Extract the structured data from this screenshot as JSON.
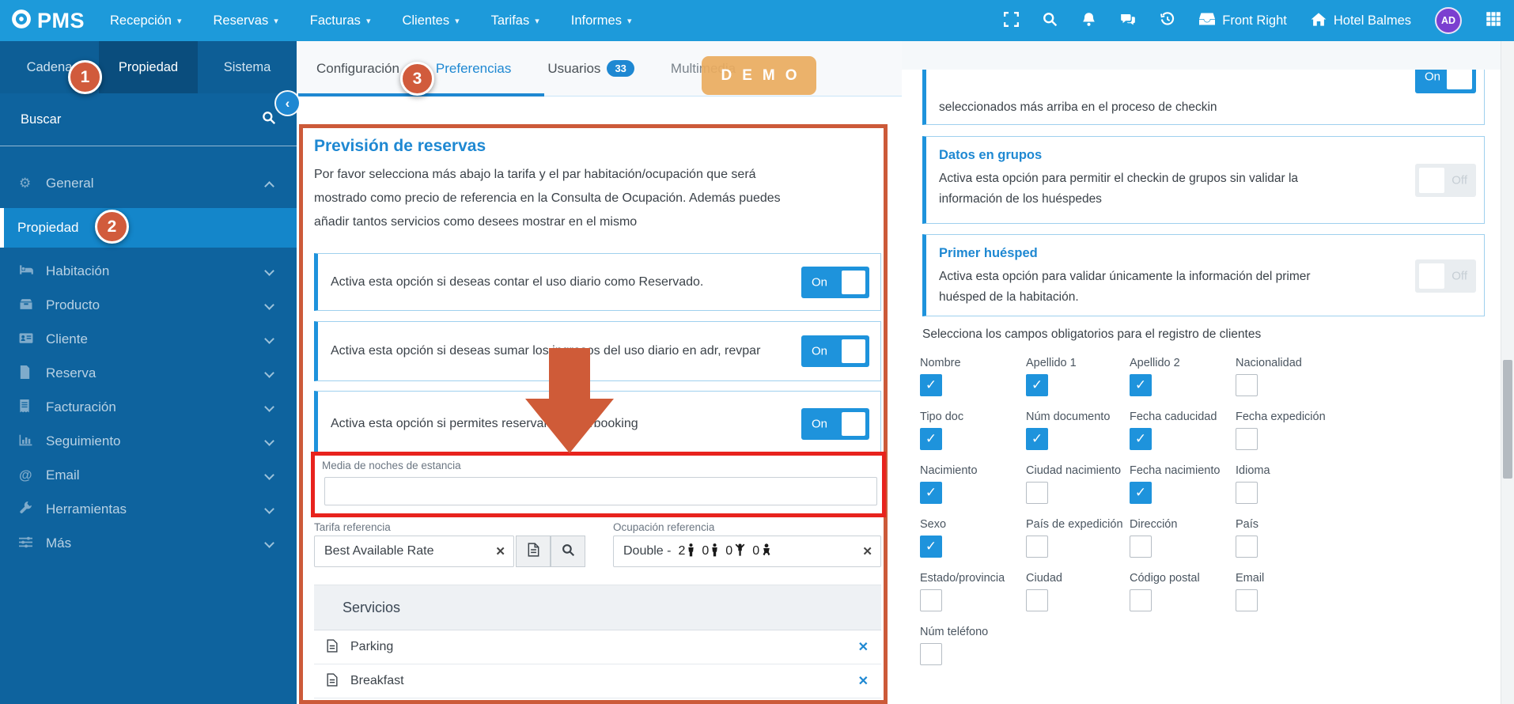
{
  "icons": {
    "check": "✓",
    "close": "✕",
    "caret_down": "▾",
    "chevron_left": "‹",
    "gear": "⚙",
    "at": "@"
  },
  "navbar": {
    "logo_text": "PMS",
    "menus": [
      "Recepción",
      "Reservas",
      "Facturas",
      "Clientes",
      "Tarifas",
      "Informes"
    ],
    "workstation_label": "Front Right",
    "hotel_label": "Hotel Balmes",
    "avatar_initials": "AD"
  },
  "sidebar": {
    "tabs": [
      "Cadena",
      "Propiedad",
      "Sistema"
    ],
    "search_placeholder": "Buscar",
    "items": [
      {
        "label": "General"
      },
      {
        "label": "Propiedad"
      },
      {
        "label": "Habitación"
      },
      {
        "label": "Producto"
      },
      {
        "label": "Cliente"
      },
      {
        "label": "Reserva"
      },
      {
        "label": "Facturación"
      },
      {
        "label": "Seguimiento"
      },
      {
        "label": "Email"
      },
      {
        "label": "Herramientas"
      },
      {
        "label": "Más"
      }
    ]
  },
  "content_tabs": {
    "configuracion": "Configuración",
    "preferencias": "Preferencias",
    "usuarios": "Usuarios",
    "usuarios_badge": "33",
    "multimedia": "Multimedia"
  },
  "demo_badge": "DEMO",
  "callout_numbers": {
    "one": "1",
    "two": "2",
    "three": "3"
  },
  "forecast": {
    "title": "Previsión de reservas",
    "description": "Por favor selecciona más abajo la tarifa y el par habitación/ocupación que será mostrado como precio de referencia en la Consulta de Ocupación. Además puedes añadir tantos servicios como desees mostrar en el mismo",
    "toggles": [
      {
        "label": "Activa esta opción si deseas contar el uso diario como Reservado.",
        "state": "On"
      },
      {
        "label": "Activa esta opción si deseas sumar los ingresos del uso diario en adr, revpar",
        "state": "On"
      },
      {
        "label": "Activa esta opción si permites reservar en overbooking",
        "state": "On"
      }
    ],
    "avg_nights_label": "Media de noches de estancia",
    "avg_nights_value": "",
    "rate_label": "Tarifa referencia",
    "rate_value": "Best Available Rate",
    "occupancy_label": "Ocupación referencia",
    "occupancy": {
      "room_type": "Double -",
      "adults": "2",
      "adults_extra": "0",
      "children": "0",
      "babies": "0"
    },
    "services_title": "Servicios",
    "services": [
      "Parking",
      "Breakfast"
    ]
  },
  "checkin": {
    "card_checkin_text": "seleccionados más arriba en el proceso de checkin",
    "card_checkin_state": "On",
    "groups_title": "Datos en grupos",
    "groups_text": "Activa esta opción para permitir el checkin de grupos sin validar la información de los huéspedes",
    "groups_state": "Off",
    "first_guest_title": "Primer huésped",
    "first_guest_text": "Activa esta opción para validar únicamente la información del primer huésped de la habitación.",
    "first_guest_state": "Off",
    "required_fields_title": "Selecciona los campos obligatorios para el registro de clientes",
    "fields": [
      {
        "label": "Nombre",
        "checked": true
      },
      {
        "label": "Apellido 1",
        "checked": true
      },
      {
        "label": "Apellido 2",
        "checked": true
      },
      {
        "label": "Nacionalidad",
        "checked": false
      },
      {
        "label": "Tipo doc",
        "checked": true
      },
      {
        "label": "Núm documento",
        "checked": true
      },
      {
        "label": "Fecha caducidad",
        "checked": true
      },
      {
        "label": "Fecha expedición",
        "checked": false
      },
      {
        "label": "Nacimiento",
        "checked": true
      },
      {
        "label": "Ciudad nacimiento",
        "checked": false
      },
      {
        "label": "Fecha nacimiento",
        "checked": true
      },
      {
        "label": "Idioma",
        "checked": false
      },
      {
        "label": "Sexo",
        "checked": true
      },
      {
        "label": "País de expedición",
        "checked": false
      },
      {
        "label": "Dirección",
        "checked": false
      },
      {
        "label": "País",
        "checked": false
      },
      {
        "label": "Estado/provincia",
        "checked": false
      },
      {
        "label": "Ciudad",
        "checked": false
      },
      {
        "label": "Código postal",
        "checked": false
      },
      {
        "label": "Email",
        "checked": false
      },
      {
        "label": "Núm teléfono",
        "checked": false
      }
    ]
  }
}
